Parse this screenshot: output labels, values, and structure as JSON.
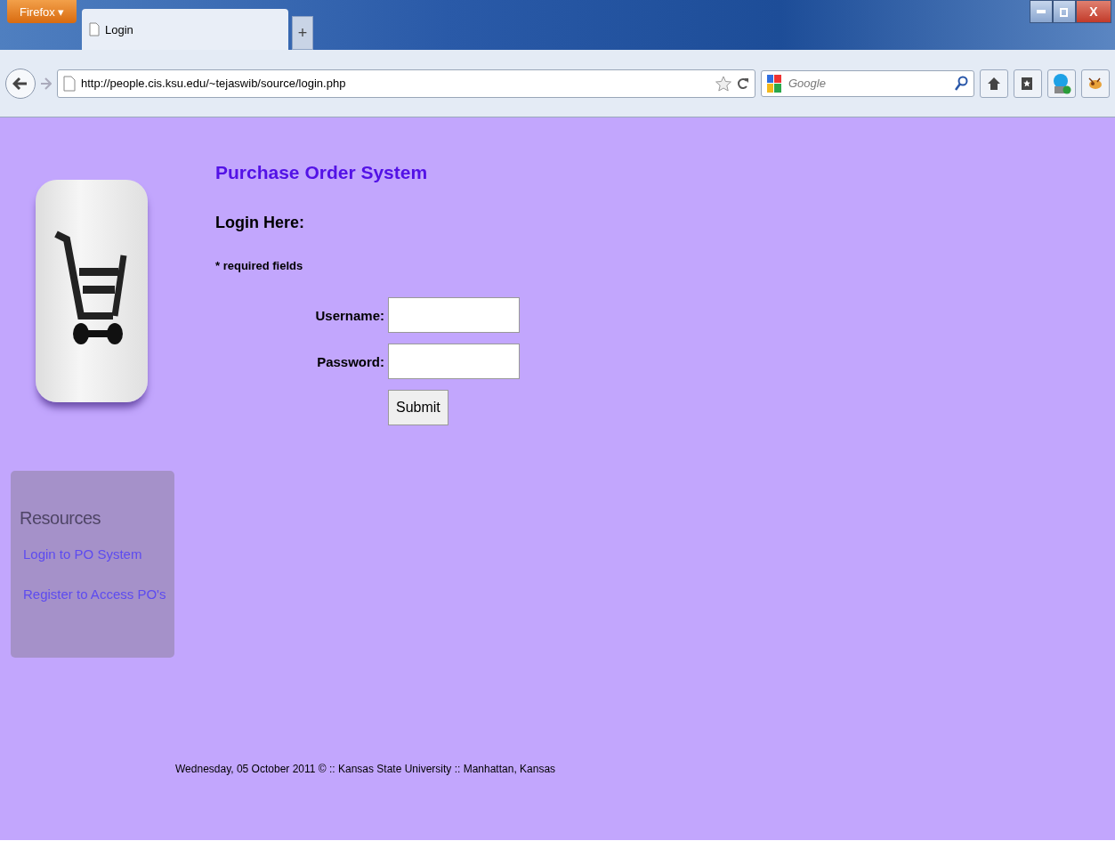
{
  "browser": {
    "menu_button": "Firefox ▾",
    "tab": {
      "title": "Login",
      "selected": true
    },
    "new_tab": "+",
    "close_label": "X",
    "url": "http://people.cis.ksu.edu/~tejaswib/source/login.php",
    "search": {
      "placeholder": "Google"
    }
  },
  "page": {
    "title": "Purchase Order System",
    "heading": "Login Here:",
    "note": "* required fields",
    "fields": [
      {
        "label": "Username:"
      },
      {
        "label": "Password:"
      }
    ],
    "submit": "Submit",
    "resources": {
      "title": "Resources",
      "links": [
        "Login to PO System",
        "Register to Access PO's"
      ]
    },
    "footer": "Wednesday, 05 October 2011  ©  :: Kansas State University :: Manhattan, Kansas"
  }
}
